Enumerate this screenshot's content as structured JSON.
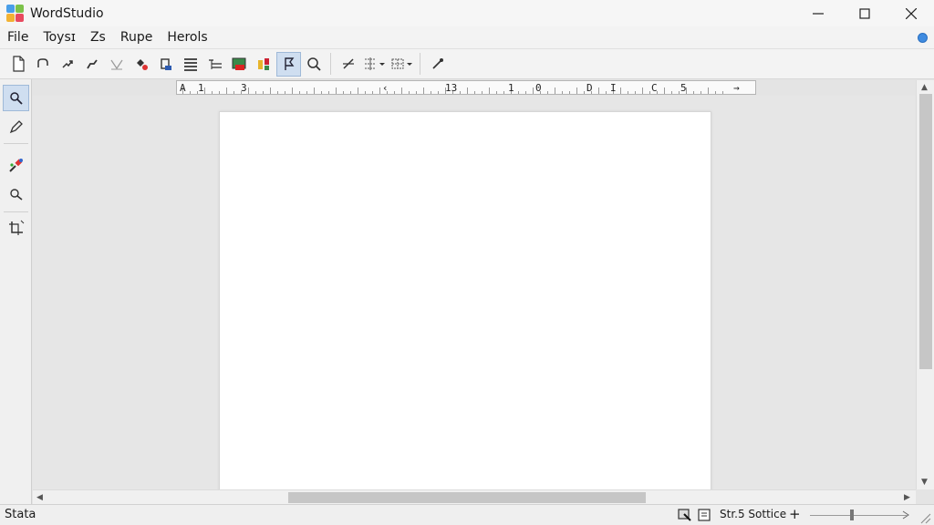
{
  "window": {
    "title": "WordStudio",
    "controls": [
      "minimize-icon",
      "maximize-icon",
      "close-icon"
    ]
  },
  "menu": {
    "items": [
      {
        "label": "File"
      },
      {
        "label": "Toysɪ"
      },
      {
        "label": "Zs"
      },
      {
        "label": "Rupe"
      },
      {
        "label": "Herols"
      }
    ],
    "help_icon": "help-icon"
  },
  "toolbar": {
    "buttons": [
      "new-document-icon",
      "undo-icon",
      "redo-icon",
      "curve-icon",
      "style-icon",
      "highlight-icon",
      "paste-icon",
      "align-justify-icon",
      "list-indent-icon",
      "insert-image-icon",
      "format-painter-icon",
      "paragraph-mark-icon",
      "search-icon",
      "split-icon",
      "columns-icon",
      "table-icon",
      "magic-icon"
    ],
    "active": "paragraph-mark-icon"
  },
  "tools": {
    "items": [
      "select-tool-icon",
      "pencil-tool-icon",
      "dropper-tool-icon",
      "zoom-tool-icon",
      "crop-tool-icon"
    ],
    "active": "select-tool-icon"
  },
  "ruler": {
    "labels": [
      "A",
      "1",
      "3",
      "‹",
      "13",
      "1",
      "0",
      "D",
      "I",
      "C",
      "5",
      "→"
    ]
  },
  "status": {
    "left_text": "Stata",
    "zoom_label": "Str.5 Sottice",
    "zoom_in_symbol": "+"
  },
  "colors": {
    "accent": "#cfdef0",
    "page": "#ffffff",
    "canvas": "#e6e6e6",
    "help": "#3f8be0"
  }
}
